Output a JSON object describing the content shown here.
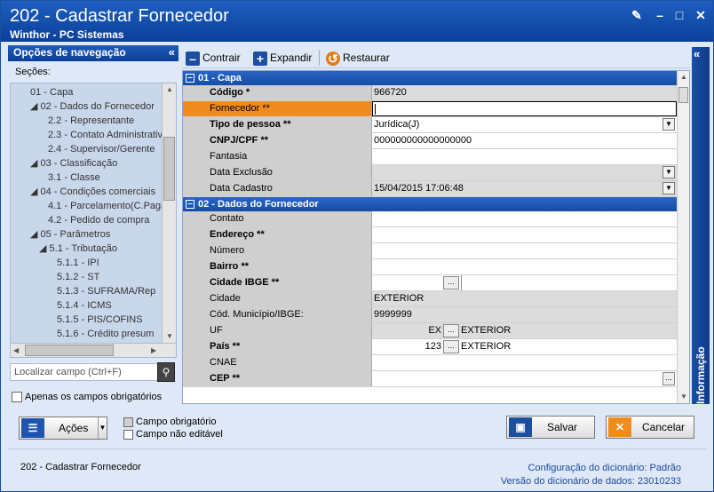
{
  "window": {
    "title": "202 - Cadastrar  Fornecedor",
    "subtitle": "Winthor - PC Sistemas"
  },
  "nav_panel": {
    "title": "Opções de navegação",
    "sections_label": "Seções:",
    "tree": [
      {
        "label": "01 - Capa",
        "indent": 0
      },
      {
        "label": "◢ 02 - Dados do Fornecedor",
        "indent": 0
      },
      {
        "label": "2.2 - Representante",
        "indent": 2
      },
      {
        "label": "2.3 - Contato Administrativ",
        "indent": 2
      },
      {
        "label": "2.4 - Supervisor/Gerente",
        "indent": 2
      },
      {
        "label": "◢ 03 - Classificação",
        "indent": 0
      },
      {
        "label": "3.1 - Classe",
        "indent": 2
      },
      {
        "label": "◢ 04 - Condições comerciais",
        "indent": 0
      },
      {
        "label": "4.1 - Parcelamento(C.Paga",
        "indent": 2
      },
      {
        "label": "4.2 - Pedido de compra",
        "indent": 2
      },
      {
        "label": "◢ 05 - Parâmetros",
        "indent": 0
      },
      {
        "label": "◢ 5.1 - Tributação",
        "indent": 1
      },
      {
        "label": "5.1.1 - IPI",
        "indent": 3
      },
      {
        "label": "5.1.2 - ST",
        "indent": 3
      },
      {
        "label": "5.1.3 - SUFRAMA/Rep",
        "indent": 3
      },
      {
        "label": "5.1.4 - ICMS",
        "indent": 3
      },
      {
        "label": "5.1.5 - PIS/COFINS",
        "indent": 3
      },
      {
        "label": "5.1.6 - Crédito presum",
        "indent": 3
      }
    ],
    "find_placeholder": "Localizar campo (Ctrl+F)",
    "only_required_label": "Apenas os campos obrigatórios"
  },
  "toolbar": {
    "collapse_label": "Contrair",
    "expand_label": "Expandir",
    "restore_label": "Restaurar"
  },
  "sections": [
    {
      "title": "01 - Capa",
      "rows": [
        {
          "label": "Código *",
          "bold": true,
          "value": "966720",
          "style": "gray"
        },
        {
          "label": "Fornecedor **",
          "bold": false,
          "value": "",
          "style": "edit",
          "selected": true
        },
        {
          "label": "Tipo de pessoa **",
          "bold": true,
          "value": "Jurídica(J)",
          "style": "white",
          "dropdown": true
        },
        {
          "label": "CNPJ/CPF **",
          "bold": true,
          "value": "000000000000000000",
          "style": "white"
        },
        {
          "label": "Fantasia",
          "bold": false,
          "value": "",
          "style": "white"
        },
        {
          "label": "Data Exclusão",
          "bold": false,
          "value": "",
          "style": "gray",
          "dropdown": true
        },
        {
          "label": "Data Cadastro",
          "bold": false,
          "value": "15/04/2015 17:06:48",
          "style": "gray",
          "dropdown": true
        }
      ]
    },
    {
      "title": "02 - Dados do Fornecedor",
      "rows": [
        {
          "label": "Contato",
          "bold": false,
          "value": "",
          "style": "white"
        },
        {
          "label": "Endereço **",
          "bold": true,
          "value": "",
          "style": "white"
        },
        {
          "label": "Número",
          "bold": false,
          "value": "",
          "style": "white"
        },
        {
          "label": "Bairro **",
          "bold": true,
          "value": "",
          "style": "white"
        },
        {
          "label": "Cidade IBGE **",
          "bold": true,
          "value": "",
          "style": "white",
          "lookup": true
        },
        {
          "label": "Cidade",
          "bold": false,
          "value": "EXTERIOR",
          "style": "gray"
        },
        {
          "label": "Cód. Município/IBGE:",
          "bold": false,
          "value": "9999999",
          "style": "gray"
        },
        {
          "label": "UF",
          "bold": false,
          "code": "EX",
          "value": "EXTERIOR",
          "style": "gray",
          "lookup": true
        },
        {
          "label": "País **",
          "bold": true,
          "code": "123",
          "value": "EXTERIOR",
          "style": "white",
          "lookup": true
        },
        {
          "label": "CNAE",
          "bold": false,
          "value": "",
          "style": "white"
        },
        {
          "label": "CEP **",
          "bold": true,
          "value": "",
          "style": "white",
          "ellipsis_right": true
        }
      ]
    }
  ],
  "info_panel": {
    "label": "Informação"
  },
  "buttons": {
    "actions_label": "Ações",
    "save_label": "Salvar",
    "cancel_label": "Cancelar"
  },
  "legend": {
    "required_label": "Campo obrigatório",
    "not_editable_label": "Campo não editável"
  },
  "footer": {
    "left": "202 - Cadastrar  Fornecedor",
    "dict_config_label": "Configuração do dicionário:",
    "dict_config_value": "Padrão",
    "dict_version_label": "Versão do dicionário de dados:",
    "dict_version_value": "23010233"
  },
  "colors": {
    "title_bar": "#0f47a6",
    "selected_row": "#f08b1e",
    "section_header": "#1f5ab8"
  }
}
